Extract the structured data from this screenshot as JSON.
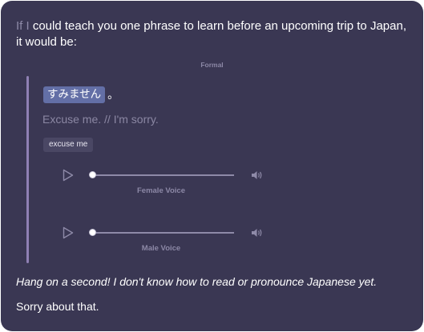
{
  "message": {
    "intro_prefix": "If I",
    "intro_rest": " could teach you one phrase to learn before an upcoming trip to Japan, it would be:",
    "register_label": "Formal",
    "phrase": {
      "japanese": "すみません",
      "punctuation": "。",
      "translation": "Excuse me. // I'm sorry.",
      "tag": "excuse me"
    },
    "players": [
      {
        "label": "Female Voice",
        "progress": 0,
        "play_icon": "play-icon",
        "volume_icon": "volume-icon"
      },
      {
        "label": "Male Voice",
        "progress": 0,
        "play_icon": "play-icon",
        "volume_icon": "volume-icon"
      }
    ],
    "reply": "Hang on a second! I don't know how to read or pronounce Japanese yet.",
    "closing": "Sorry about that."
  },
  "colors": {
    "card_background": "#3a3753",
    "quote_bar": "#8f80b4",
    "highlight": "#636fa6",
    "muted_text": "#8b87a3"
  }
}
